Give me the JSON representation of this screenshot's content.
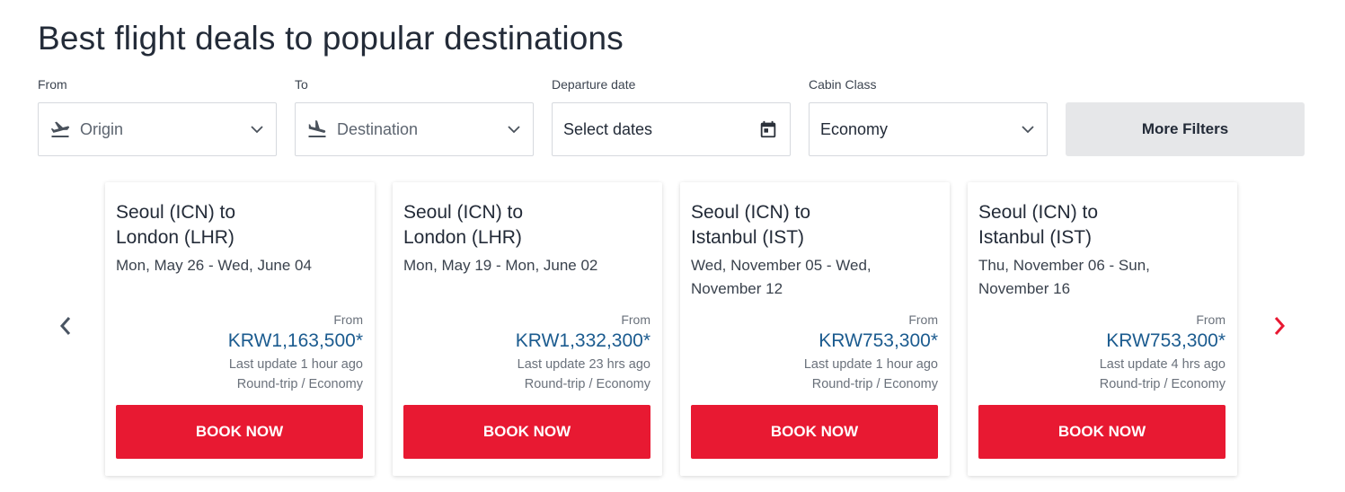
{
  "header": {
    "title": "Best flight deals to popular destinations"
  },
  "filters": {
    "from": {
      "label": "From",
      "placeholder": "Origin",
      "icon": "plane-takeoff-icon"
    },
    "to": {
      "label": "To",
      "placeholder": "Destination",
      "icon": "plane-landing-icon"
    },
    "departure": {
      "label": "Departure date",
      "value": "Select dates",
      "icon": "calendar-icon"
    },
    "cabin": {
      "label": "Cabin Class",
      "value": "Economy"
    },
    "more_filters_label": "More Filters"
  },
  "carousel": {
    "prev_icon": "chevron-left-icon",
    "next_icon": "chevron-right-icon",
    "cards": [
      {
        "route_line1": "Seoul (ICN) to",
        "route_line2": "London (LHR)",
        "dates": "Mon, May 26 - Wed, June 04",
        "from_label": "From",
        "price": "KRW1,163,500*",
        "updated": "Last update 1 hour ago",
        "trip": "Round-trip / Economy",
        "book_label": "BOOK NOW"
      },
      {
        "route_line1": "Seoul (ICN) to",
        "route_line2": "London (LHR)",
        "dates": "Mon, May 19 - Mon, June 02",
        "from_label": "From",
        "price": "KRW1,332,300*",
        "updated": "Last update 23 hrs ago",
        "trip": "Round-trip / Economy",
        "book_label": "BOOK NOW"
      },
      {
        "route_line1": "Seoul (ICN) to",
        "route_line2": "Istanbul (IST)",
        "dates": "Wed, November 05 - Wed, November 12",
        "from_label": "From",
        "price": "KRW753,300*",
        "updated": "Last update 1 hour ago",
        "trip": "Round-trip / Economy",
        "book_label": "BOOK NOW"
      },
      {
        "route_line1": "Seoul (ICN) to",
        "route_line2": "Istanbul (IST)",
        "dates": "Thu, November 06 - Sun, November 16",
        "from_label": "From",
        "price": "KRW753,300*",
        "updated": "Last update 4 hrs ago",
        "trip": "Round-trip / Economy",
        "book_label": "BOOK NOW"
      }
    ]
  },
  "colors": {
    "accent_red": "#e81932",
    "price_blue": "#1b5b8f",
    "text_dark": "#232b38"
  }
}
